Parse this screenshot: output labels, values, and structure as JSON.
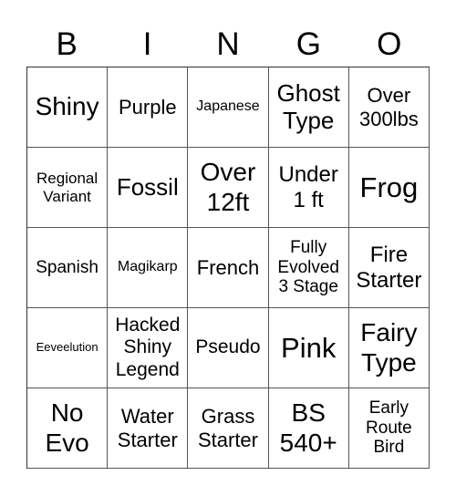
{
  "header": {
    "letters": [
      "B",
      "I",
      "N",
      "G",
      "O"
    ]
  },
  "card": {
    "rows": [
      [
        "Shiny",
        "Purple",
        "Japanese",
        "Ghost\nType",
        "Over\n300lbs"
      ],
      [
        "Regional\nVariant",
        "Fossil",
        "Over\n12ft",
        "Under\n1 ft",
        "Frog"
      ],
      [
        "Spanish",
        "Magikarp",
        "French",
        "Fully\nEvolved\n3 Stage",
        "Fire\nStarter"
      ],
      [
        "Eeveelution",
        "Hacked\nShiny\nLegend",
        "Pseudo",
        "Pink",
        "Fairy\nType"
      ],
      [
        "No\nEvo",
        "Water\nStarter",
        "Grass\nStarter",
        "BS\n540+",
        "Early\nRoute\nBird"
      ]
    ]
  }
}
